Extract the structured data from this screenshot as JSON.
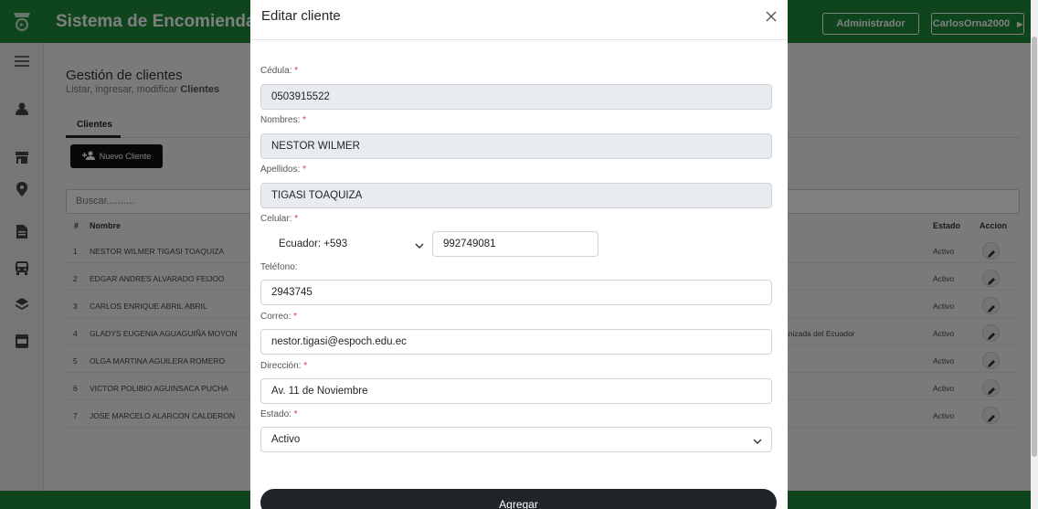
{
  "app": {
    "title": "Sistema de Encomiendas",
    "role_button": "Administrador",
    "user_button": "CarlosOrna2000"
  },
  "page": {
    "title": "Gestión de clientes",
    "subtitle_prefix": "Listar, ingresar, modificar",
    "subtitle_bold": "Clientes"
  },
  "tabs": [
    {
      "label": "Clientes"
    }
  ],
  "new_client_button": "Nuevo Cliente",
  "search": {
    "placeholder": "Buscar.........."
  },
  "table": {
    "headers": {
      "num": "#",
      "name": "Nombre",
      "status": "Estado",
      "action": "Accion"
    },
    "rows": [
      {
        "num": "1",
        "name": "NESTOR WILMER TIGASI TOAQUIZA",
        "extra": "",
        "status": "Activo"
      },
      {
        "num": "2",
        "name": "EDGAR ANDRES ALVARADO FEIJOO",
        "extra": "",
        "status": "Activo"
      },
      {
        "num": "3",
        "name": "CARLOS ENRIQUE ABRIL ABRIL",
        "extra": "",
        "status": "Activo"
      },
      {
        "num": "4",
        "name": "GLADYS EUGENIA AGUAGUIÑA MOYON",
        "extra": "anizada del Ecuador",
        "status": "Activo"
      },
      {
        "num": "5",
        "name": "OLGA MARTINA AGUILERA ROMERO",
        "extra": "",
        "status": "Activo"
      },
      {
        "num": "6",
        "name": "VICTOR POLIBIO AGUINSACA PUCHA",
        "extra": "",
        "status": "Activo"
      },
      {
        "num": "7",
        "name": "JOSE MARCELO ALARCON CALDERON",
        "extra": "",
        "status": "Activo"
      }
    ]
  },
  "modal": {
    "title": "Editar cliente",
    "fields": {
      "cedula": {
        "label": "Cédula:",
        "required": "*",
        "value": "0503915522"
      },
      "nombres": {
        "label": "Nombres:",
        "required": "*",
        "value": "NESTOR WILMER"
      },
      "apellidos": {
        "label": "Apellidos:",
        "required": "*",
        "value": "TIGASI TOAQUIZA"
      },
      "celular": {
        "label": "Celular:",
        "required": "*",
        "country": "Ecuador: +593",
        "value": "992749081"
      },
      "telefono": {
        "label": "Teléfono:",
        "value": "2943745"
      },
      "correo": {
        "label": "Correo:",
        "required": "*",
        "value": "nestor.tigasi@espoch.edu.ec"
      },
      "direccion": {
        "label": "Dirección:",
        "required": "*",
        "value": "Av. 11 de Noviembre"
      },
      "estado": {
        "label": "Estado:",
        "required": "*",
        "value": "Activo"
      }
    },
    "submit_label": "Agregar"
  },
  "colors": {
    "brand_green": "#1f8b3a",
    "overlay": "rgba(0,0,0,0.5)",
    "required": "#dc3545",
    "dark_button": "#212529"
  },
  "icons": [
    "logo-icon",
    "menu-icon",
    "user-icon",
    "store-icon",
    "location-icon",
    "document-icon",
    "bus-icon",
    "layers-icon",
    "pdf-icon",
    "add-user-icon",
    "edit-icon",
    "close-icon",
    "chevron-down-icon",
    "chevron-right-icon"
  ]
}
